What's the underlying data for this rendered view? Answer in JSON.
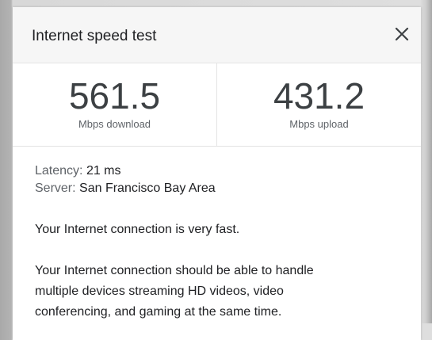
{
  "dialog": {
    "title": "Internet speed test",
    "close_icon": "close-icon"
  },
  "download": {
    "value": "561.5",
    "unit": "Mbps download"
  },
  "upload": {
    "value": "431.2",
    "unit": "Mbps upload"
  },
  "details": {
    "latency_label": "Latency:",
    "latency_value": "21 ms",
    "server_label": "Server:",
    "server_value": "San Francisco Bay Area"
  },
  "summary": "Your Internet connection is very fast.",
  "description": {
    "line1": "Your Internet connection should be able to handle",
    "line2": "multiple devices streaming HD videos, video",
    "line3": "conferencing, and gaming at the same time."
  }
}
